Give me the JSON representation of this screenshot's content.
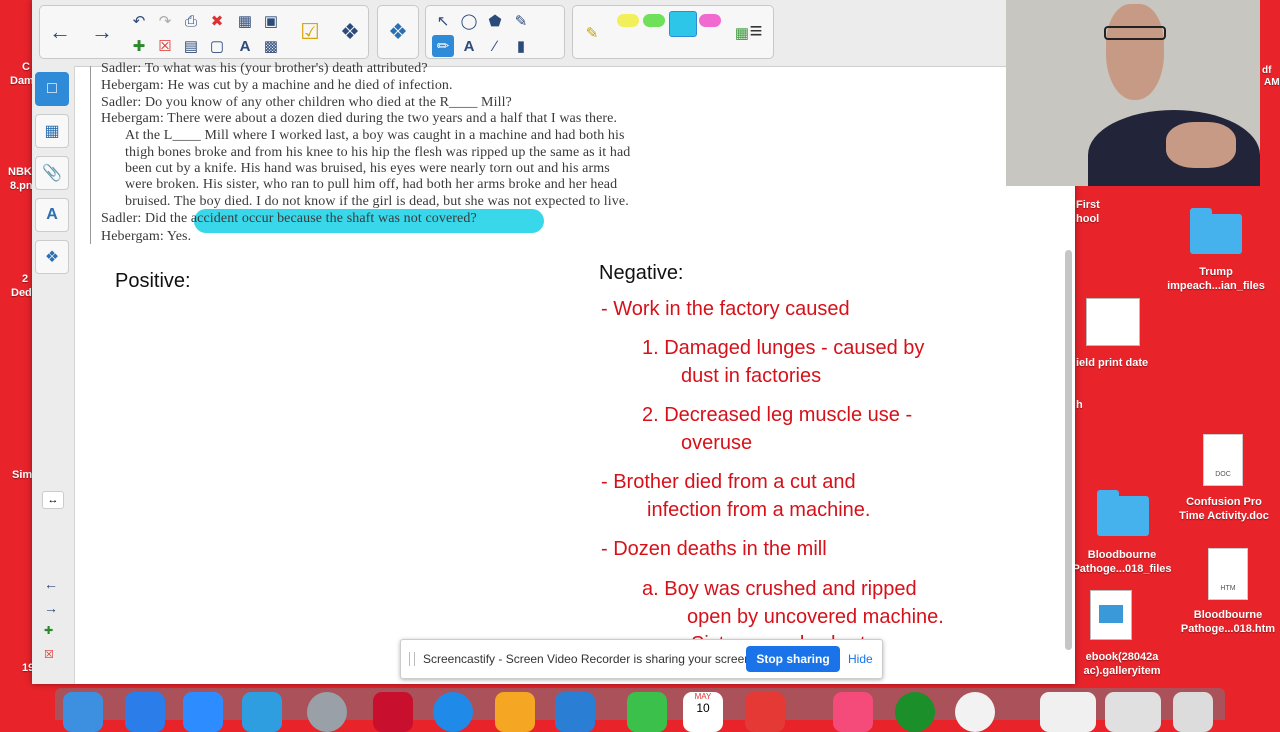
{
  "colors": {
    "desktop_bg": "#e8232a",
    "highlight": "#22d3e8",
    "negative_text": "#d6111a",
    "accent_button": "#1a73e8"
  },
  "desktop": {
    "left_fragments": [
      "C",
      "Dam",
      "NBK",
      "8.pn",
      "2",
      "Ded",
      "Sim",
      "19"
    ],
    "right_fragments": [
      "df",
      "AM",
      "First",
      "hool",
      "ield print date",
      "h"
    ],
    "icons": [
      {
        "label": "Trump impeach...ian_files",
        "kind": "folder"
      },
      {
        "label": "Confusion Pro Time Activity.doc",
        "kind": "doc",
        "badge": "DOC"
      },
      {
        "label": "Bloodbourne Pathoge...018_files",
        "kind": "folder"
      },
      {
        "label": "Bloodbourne Pathoge...018.htm",
        "kind": "doc",
        "badge": "HTM"
      },
      {
        "label": "ebook(28042a ac).galleryitem",
        "kind": "gallery"
      }
    ]
  },
  "toolbar": {
    "icons": [
      "back-arrow",
      "forward-arrow",
      "undo",
      "redo",
      "paste",
      "delete",
      "table",
      "screenshot",
      "add-page",
      "delete-page",
      "save",
      "full-screen",
      "text-recognition",
      "capture",
      "check",
      "add-on",
      "select",
      "shapes",
      "fill",
      "eraser-pen",
      "pen",
      "text",
      "line",
      "eraser",
      "highlighter",
      "properties"
    ]
  },
  "sidebar": {
    "items": [
      "page-sorter",
      "gallery",
      "attachments",
      "properties",
      "add-ons"
    ],
    "nav": [
      "prev-page",
      "next-page",
      "add-page",
      "delete-page"
    ]
  },
  "document": {
    "scan_lines": [
      "Sadler: To what was his (your brother's) death attributed?",
      "Hebergam: He was cut by a machine and he died of infection.",
      "Sadler: Do you know of any other children who died at the R____ Mill?",
      "Hebergam: There were about a dozen died during the two years and a half that I was there.",
      "At the L____ Mill where I worked last, a boy was caught in a machine and had both his",
      "thigh bones broke and from his knee to his hip the flesh was ripped up the same as it had",
      "been cut by a knife. His hand was bruised, his eyes were nearly torn out and his arms",
      "were broken. His sister, who ran to pull him off, had both her arms broke and her head",
      "bruised. The boy died. I do not know if the girl is dead, but she was not expected to live.",
      "Sadler: Did the accident occur because the shaft was not covered?",
      "Hebergam: Yes."
    ],
    "positive_heading": "Positive:",
    "negative_heading": "Negative:",
    "negative_lines": [
      "- Work in the factory caused",
      "1. Damaged lunges - caused by",
      "dust in factories",
      "2.  Decreased leg muscle use -",
      "overuse",
      "- Brother died from a cut and",
      "infection from a machine.",
      "-  Dozen deaths in the mill",
      "a.  Boy was crushed and ripped",
      "open by uncovered machine.",
      "Sister was also hurt"
    ]
  },
  "screencast": {
    "message": "Screencastify - Screen Video Recorder is sharing your screen.",
    "stop_label": "Stop sharing",
    "hide_label": "Hide"
  },
  "dock": {
    "calendar_month": "MAY",
    "calendar_day": "10"
  }
}
